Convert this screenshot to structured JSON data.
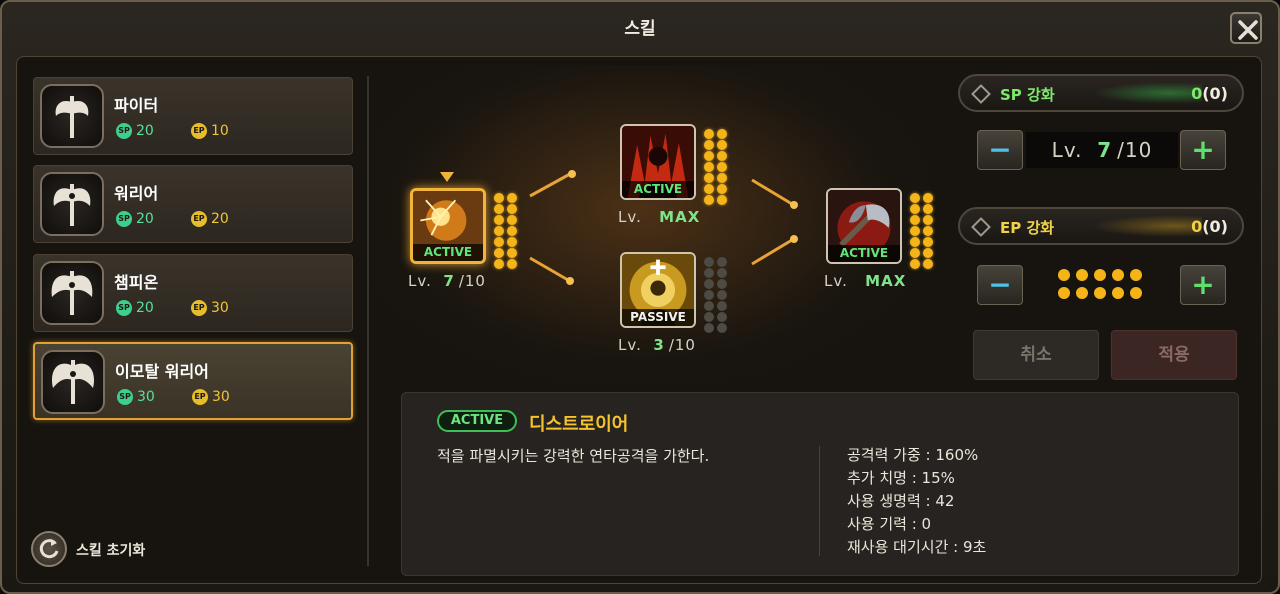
{
  "window": {
    "title": "스킬"
  },
  "classes": [
    {
      "name": "파이터",
      "sp": "20",
      "ep": "10",
      "selected": false
    },
    {
      "name": "워리어",
      "sp": "20",
      "ep": "20",
      "selected": false
    },
    {
      "name": "챔피온",
      "sp": "20",
      "ep": "30",
      "selected": false
    },
    {
      "name": "이모탈 워리어",
      "sp": "30",
      "ep": "30",
      "selected": true
    }
  ],
  "badges": {
    "sp": "SP",
    "ep": "EP"
  },
  "reset": {
    "label": "스킬 초기화"
  },
  "skills": {
    "left": {
      "type": "ACTIVE",
      "lv_prefix": "Lv.",
      "level": "7",
      "sep": "/",
      "max": "10",
      "pips_on": 14,
      "pips_total": 14
    },
    "top": {
      "type": "ACTIVE",
      "lv_prefix": "Lv.",
      "level_text": "MAX",
      "pips_on": 14,
      "pips_total": 14
    },
    "bottom": {
      "type": "PASSIVE",
      "lv_prefix": "Lv.",
      "level": "3",
      "sep": "/",
      "max": "10",
      "pips_on": 0,
      "pips_total": 14
    },
    "right": {
      "type": "ACTIVE",
      "lv_prefix": "Lv.",
      "level_text": "MAX",
      "pips_on": 14,
      "pips_total": 14
    }
  },
  "enhance": {
    "sp": {
      "label": "SP 강화",
      "value": "0",
      "total": "(0)",
      "color": "#7ee86e"
    },
    "ep": {
      "label": "EP 강화",
      "value": "0",
      "total": "(0)",
      "color": "#f0d24a"
    },
    "level_box": {
      "prefix": "Lv.",
      "level": "7",
      "sep": "/",
      "max": "10"
    },
    "ep_dots": 10,
    "minus": "−",
    "plus": "+"
  },
  "actions": {
    "cancel": "취소",
    "apply": "적용"
  },
  "description": {
    "type": "ACTIVE",
    "name": "디스트로이어",
    "text": "적을 파멸시키는 강력한 연타공격을 가한다.",
    "stats": [
      "공격력 가중 : 160%",
      "추가 치명 : 15%",
      "사용 생명력 : 42",
      "사용 기력 : 0",
      "재사용 대기시간 : 9초"
    ]
  },
  "colors": {
    "accent": "#f0b43a",
    "sp": "#3fcf8d",
    "ep": "#e6bd2a",
    "active_green": "#5ee87a"
  }
}
